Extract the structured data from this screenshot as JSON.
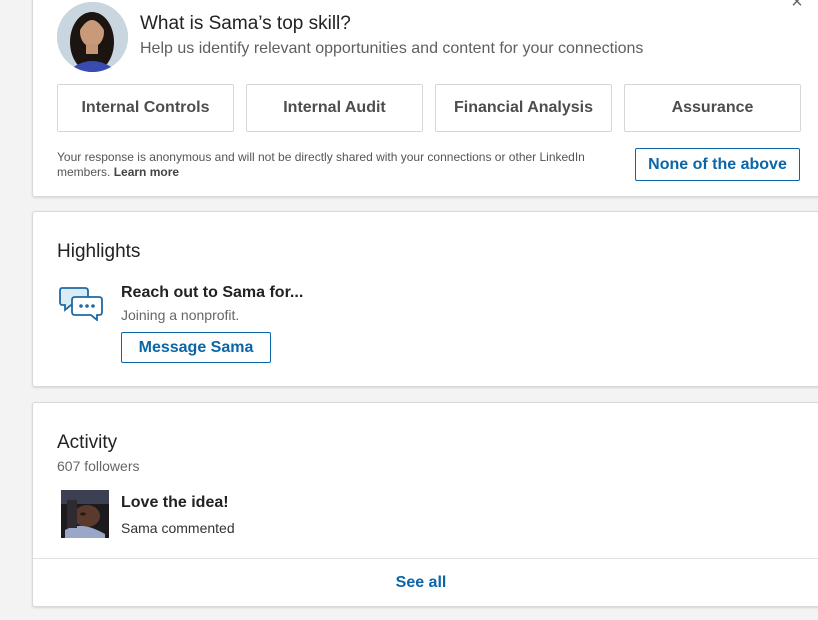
{
  "skill_prompt": {
    "title": "What is Sama’s top skill?",
    "subtitle": "Help us identify relevant opportunities and content for your connections",
    "close_icon": "×",
    "options": [
      "Internal Controls",
      "Internal Audit",
      "Financial Analysis",
      "Assurance"
    ],
    "anonymous_note": "Your response is anonymous and will not be directly shared with your connections or other LinkedIn members.",
    "learn_more": "Learn more",
    "none_label": "None of the above"
  },
  "highlights": {
    "title": "Highlights",
    "icon": "chat-bubbles-icon",
    "heading": "Reach out to Sama for...",
    "detail": "Joining a nonprofit.",
    "message_label": "Message Sama"
  },
  "activity": {
    "title": "Activity",
    "followers": "607 followers",
    "post_heading": "Love the idea!",
    "post_meta": "Sama commented",
    "see_all": "See all"
  },
  "colors": {
    "accent": "#0a66a8",
    "background": "#f3f3f3",
    "card": "#ffffff"
  }
}
